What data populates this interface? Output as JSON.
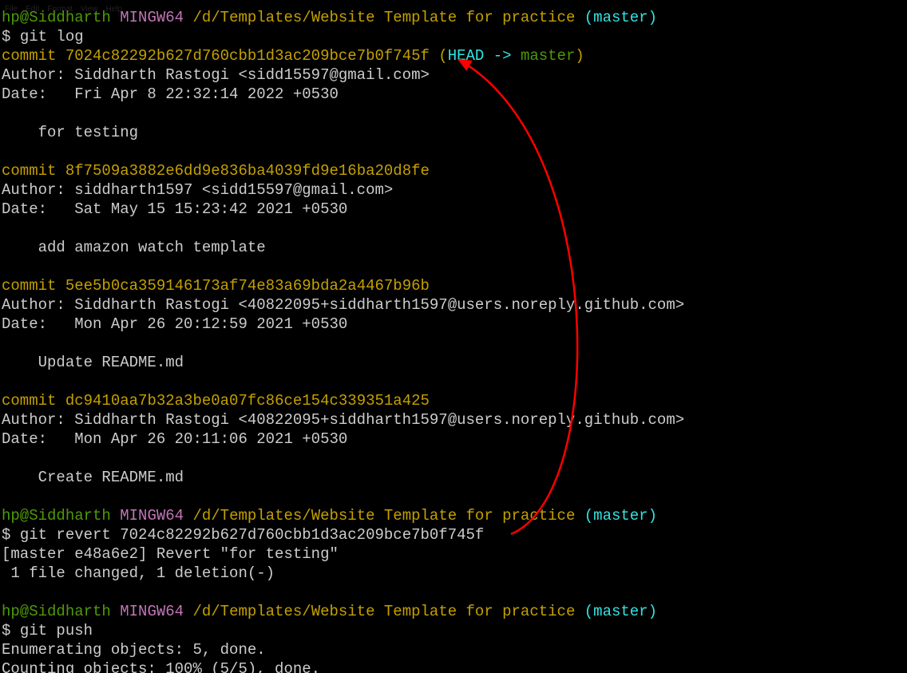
{
  "menu": {
    "file": "File",
    "edit": "Edit",
    "format": "Format",
    "view": "View",
    "help": "Help"
  },
  "prompt": {
    "user": "hp@Siddharth",
    "host": "MINGW64",
    "path": "/d/Templates/Website Template for practice",
    "branch": "(master)",
    "dollar": "$ "
  },
  "cmd1": "git log",
  "log": [
    {
      "commit_label": "commit ",
      "hash": "7024c82292b627d760cbb1d3ac209bce7b0f745f",
      "ref_open": " (",
      "ref_head": "HEAD -> ",
      "ref_branch": "master",
      "ref_close": ")",
      "author": "Author: Siddharth Rastogi <sidd15597@gmail.com>",
      "date": "Date:   Fri Apr 8 22:32:14 2022 +0530",
      "msg": "    for testing"
    },
    {
      "commit_label": "commit ",
      "hash": "8f7509a3882e6dd9e836ba4039fd9e16ba20d8fe",
      "author": "Author: siddharth1597 <sidd15597@gmail.com>",
      "date": "Date:   Sat May 15 15:23:42 2021 +0530",
      "msg": "    add amazon watch template"
    },
    {
      "commit_label": "commit ",
      "hash": "5ee5b0ca359146173af74e83a69bda2a4467b96b",
      "author": "Author: Siddharth Rastogi <40822095+siddharth1597@users.noreply.github.com>",
      "date": "Date:   Mon Apr 26 20:12:59 2021 +0530",
      "msg": "    Update README.md"
    },
    {
      "commit_label": "commit ",
      "hash": "dc9410aa7b32a3be0a07fc86ce154c339351a425",
      "author": "Author: Siddharth Rastogi <40822095+siddharth1597@users.noreply.github.com>",
      "date": "Date:   Mon Apr 26 20:11:06 2021 +0530",
      "msg": "    Create README.md"
    }
  ],
  "cmd2": "git revert 7024c82292b627d760cbb1d3ac209bce7b0f745f",
  "revert_out1": "[master e48a6e2] Revert \"for testing\"",
  "revert_out2": " 1 file changed, 1 deletion(-)",
  "cmd3": "git push",
  "push_out1": "Enumerating objects: 5, done.",
  "push_out2": "Counting objects: 100% (5/5), done."
}
